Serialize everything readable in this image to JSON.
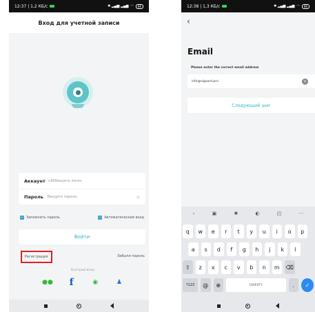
{
  "left_phone": {
    "status": {
      "time": "12:37 | 1,2 КБ/с",
      "battery": "86"
    },
    "title": "Вход для учетной записи",
    "account_label": "Аккаунт",
    "account_placeholder": "+86Введите логин",
    "password_label": "Пароль",
    "password_placeholder": "Введите пароль",
    "remember_label": "Запомнить пароль",
    "auto_login_label": "Автоматический вход",
    "login_button": "Войти",
    "register_link": "Регистрация",
    "forgot_link": "Забыли пароль",
    "quick_login_label": "Быстрый вход",
    "social_icons": [
      "wechat-icon",
      "facebook-icon",
      "line-icon",
      "user-icon"
    ],
    "accent_color": "#2eb4c2",
    "highlight_color": "#e0201c"
  },
  "right_phone": {
    "status": {
      "time": "12:38 | 1,3 КБ/с",
      "battery": "86"
    },
    "heading": "Email",
    "hint": "Please enter the correct email address",
    "email_value": "info@viguard.pro",
    "next_button": "Следующий шаг",
    "keyboard": {
      "row1": [
        "q",
        "w",
        "e",
        "r",
        "t",
        "y",
        "u",
        "i",
        "o",
        "p"
      ],
      "row2": [
        "a",
        "s",
        "d",
        "f",
        "g",
        "h",
        "j",
        "k",
        "l"
      ],
      "row3": [
        "z",
        "x",
        "c",
        "v",
        "b",
        "n",
        "m"
      ],
      "symbols_key": "?123",
      "at_key": "@",
      "space_label": "QWERTY",
      "period_key": "."
    }
  }
}
